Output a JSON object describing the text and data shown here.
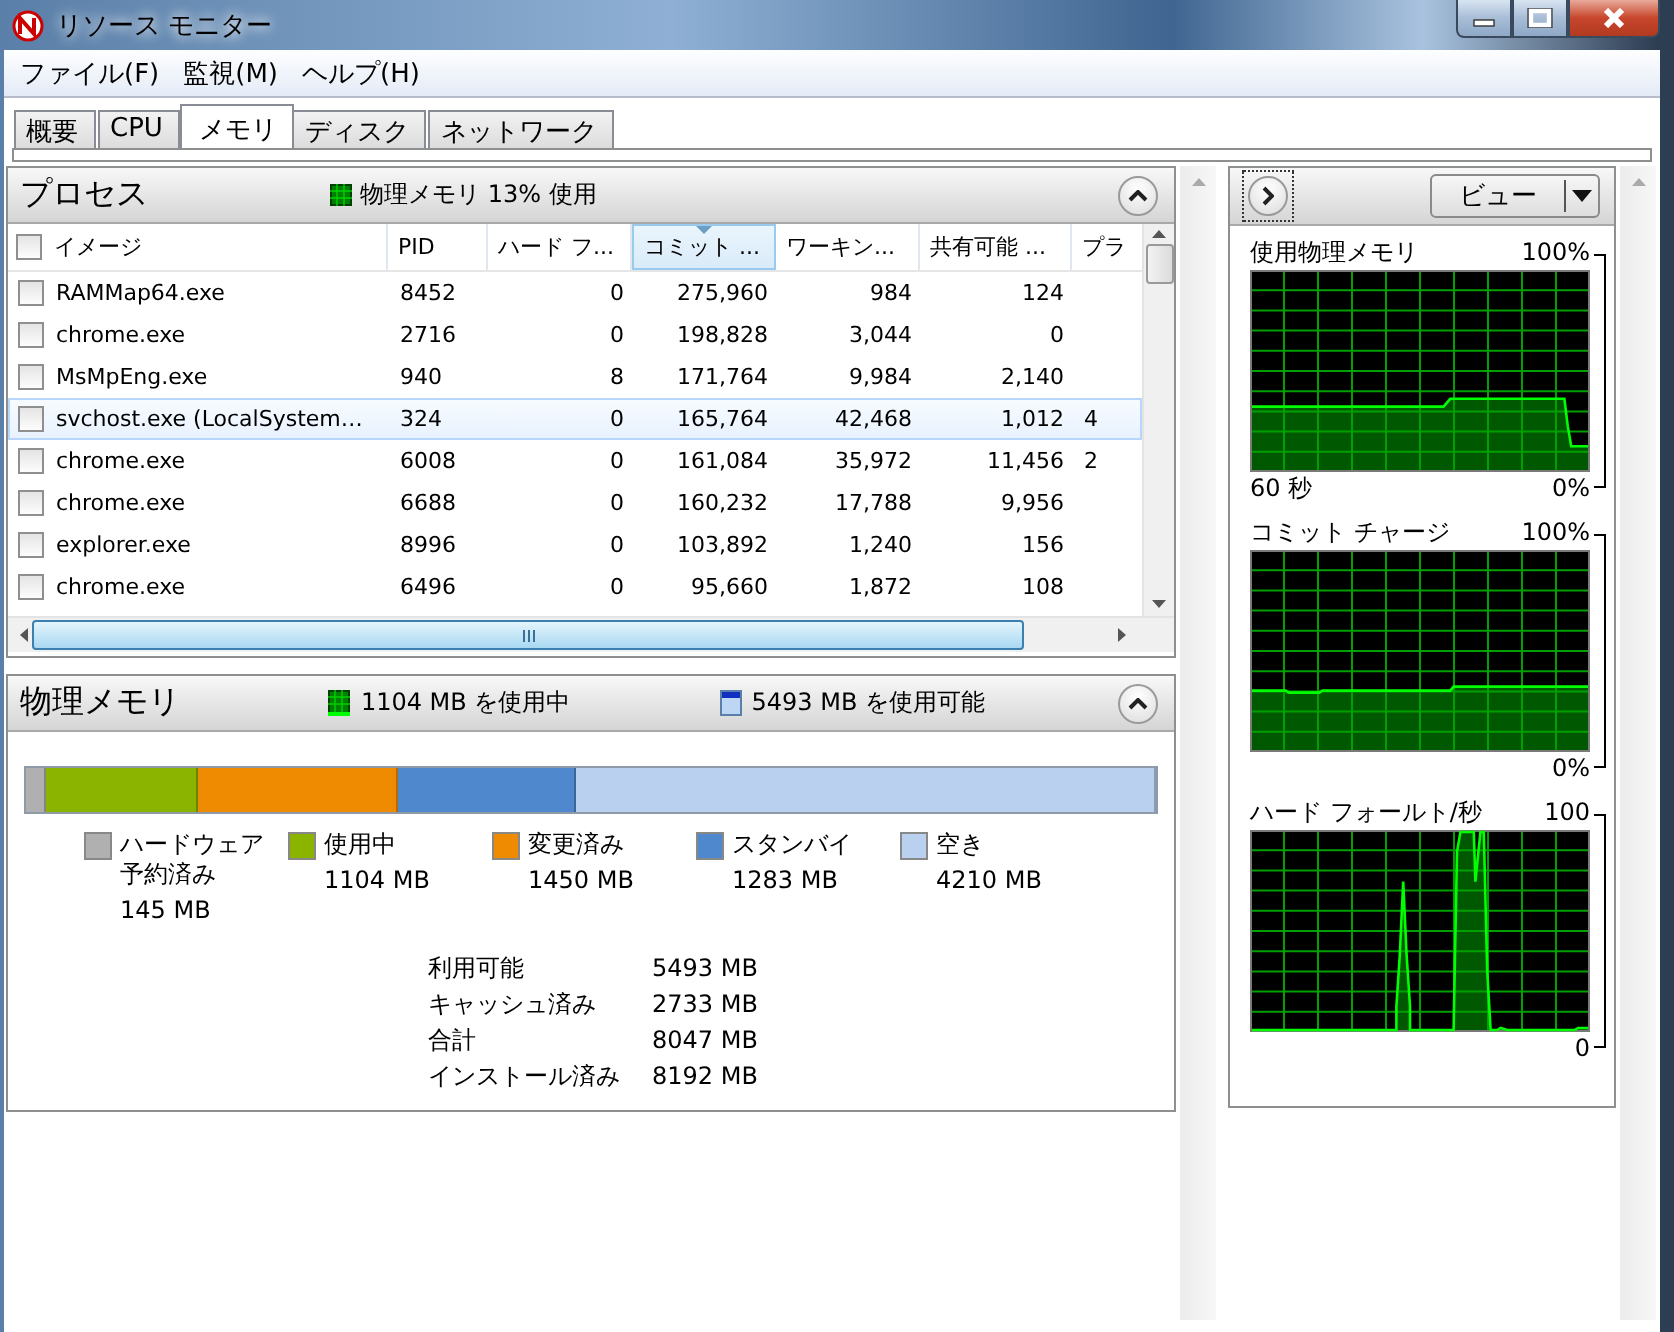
{
  "window": {
    "title": "リソース モニター"
  },
  "menu": [
    {
      "label": "ファイル(F)"
    },
    {
      "label": "監視(M)"
    },
    {
      "label": "ヘルプ(H)"
    }
  ],
  "tabs": [
    {
      "label": "概要",
      "selected": false
    },
    {
      "label": "CPU",
      "selected": false
    },
    {
      "label": "メモリ",
      "selected": true
    },
    {
      "label": "ディスク",
      "selected": false
    },
    {
      "label": "ネットワーク",
      "selected": false
    }
  ],
  "processes": {
    "title": "プロセス",
    "summary": "物理メモリ 13% 使用",
    "all_checked": false,
    "columns": [
      {
        "label": "イメージ",
        "sorted": false
      },
      {
        "label": "PID",
        "sorted": false
      },
      {
        "label": "ハード フ...",
        "sorted": false
      },
      {
        "label": "コミット ...",
        "sorted": true
      },
      {
        "label": "ワーキン...",
        "sorted": false
      },
      {
        "label": "共有可能 ...",
        "sorted": false
      },
      {
        "label": "プラ",
        "sorted": false
      }
    ],
    "rows": [
      {
        "checked": false,
        "selected": false,
        "cells": [
          "RAMMap64.exe",
          "8452",
          "0",
          "275,960",
          "984",
          "124"
        ]
      },
      {
        "checked": false,
        "selected": false,
        "cells": [
          "chrome.exe",
          "2716",
          "0",
          "198,828",
          "3,044",
          "0"
        ]
      },
      {
        "checked": false,
        "selected": false,
        "cells": [
          "MsMpEng.exe",
          "940",
          "8",
          "171,764",
          "9,984",
          "2,140"
        ]
      },
      {
        "checked": false,
        "selected": true,
        "cells": [
          "svchost.exe (LocalSystem…",
          "324",
          "0",
          "165,764",
          "42,468",
          "1,012",
          "4"
        ]
      },
      {
        "checked": false,
        "selected": false,
        "cells": [
          "chrome.exe",
          "6008",
          "0",
          "161,084",
          "35,972",
          "11,456",
          "2"
        ]
      },
      {
        "checked": false,
        "selected": false,
        "cells": [
          "chrome.exe",
          "6688",
          "0",
          "160,232",
          "17,788",
          "9,956"
        ]
      },
      {
        "checked": false,
        "selected": false,
        "cells": [
          "explorer.exe",
          "8996",
          "0",
          "103,892",
          "1,240",
          "156"
        ]
      },
      {
        "checked": false,
        "selected": false,
        "cells": [
          "chrome.exe",
          "6496",
          "0",
          "95,660",
          "1,872",
          "108"
        ]
      }
    ]
  },
  "physical_memory": {
    "title": "物理メモリ",
    "summary": [
      {
        "label": "1104 MB を使用中",
        "kind": "grid"
      },
      {
        "label": "5493 MB を使用可能",
        "kind": "gauge"
      }
    ],
    "segments": [
      {
        "label": "ハードウェア予約済み",
        "value": "145 MB",
        "color": "#b0b0b0"
      },
      {
        "label": "使用中",
        "value": "1104 MB",
        "color": "#8bb400"
      },
      {
        "label": "変更済み",
        "value": "1450 MB",
        "color": "#ef8b00"
      },
      {
        "label": "スタンバイ",
        "value": "1283 MB",
        "color": "#4f88cc"
      },
      {
        "label": "空き",
        "value": "4210 MB",
        "color": "#b9d1ee"
      }
    ],
    "stats": [
      {
        "label": "利用可能",
        "value": "5493 MB"
      },
      {
        "label": "キャッシュ済み",
        "value": "2733 MB"
      },
      {
        "label": "合計",
        "value": "8047 MB"
      },
      {
        "label": "インストール済み",
        "value": "8192 MB"
      }
    ]
  },
  "graphs_pane": {
    "view_button": "ビュー",
    "graphs": [
      {
        "title": "使用物理メモリ",
        "max_label": "100%",
        "min_label": "0%",
        "time_label": "60 秒"
      },
      {
        "title": "コミット チャージ",
        "max_label": "100%",
        "min_label": "0%"
      },
      {
        "title": "ハード フォールト/秒",
        "max_label": "100",
        "min_label": "0"
      }
    ]
  }
}
